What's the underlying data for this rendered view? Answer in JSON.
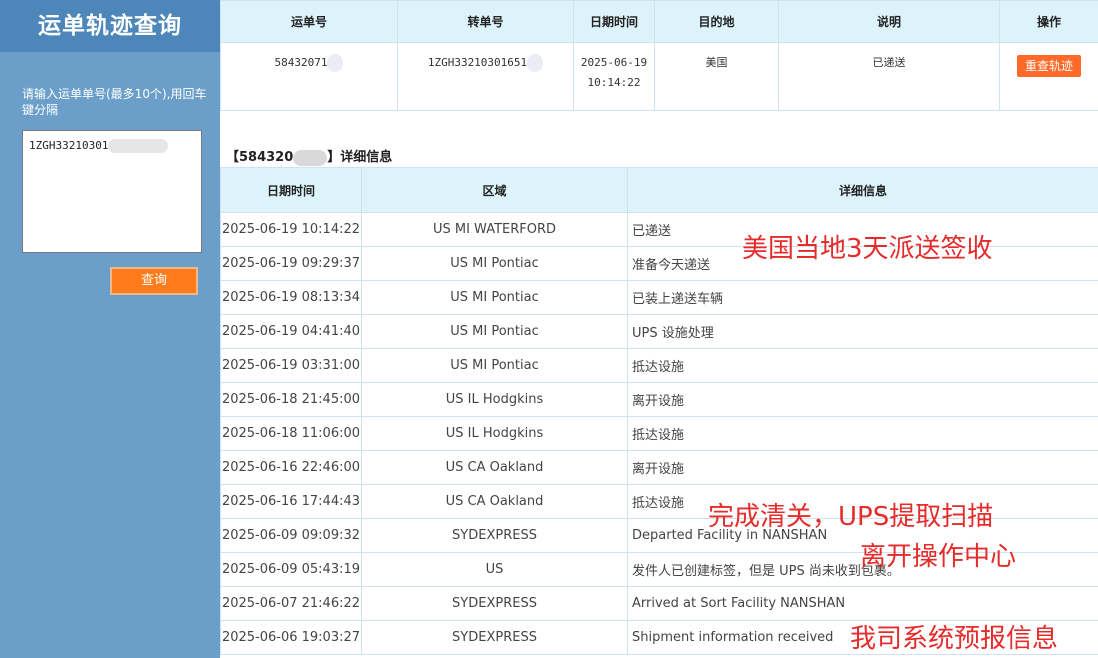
{
  "sidebar": {
    "title": "运单轨迹查询",
    "hint": "请输入运单单号(最多10个),用回车键分隔",
    "textarea_value": "1ZGH33210301",
    "query_label": "查询"
  },
  "summary": {
    "headers": [
      "运单号",
      "转单号",
      "日期时间",
      "目的地",
      "说明",
      "操作"
    ],
    "row": {
      "waybill": "58432071",
      "transfer": "1ZGH33210301651",
      "date": "2025-06-19",
      "time": "10:14:22",
      "destination": "美国",
      "note": "已递送",
      "action": "重查轨迹"
    }
  },
  "detail": {
    "heading_prefix": "【584320",
    "heading_suffix": "】详细信息",
    "headers": [
      "日期时间",
      "区域",
      "详细信息"
    ],
    "rows": [
      {
        "datetime": "2025-06-19 10:14:22",
        "area": "US MI WATERFORD",
        "info": "已递送"
      },
      {
        "datetime": "2025-06-19 09:29:37",
        "area": "US MI Pontiac",
        "info": "准备今天递送"
      },
      {
        "datetime": "2025-06-19 08:13:34",
        "area": "US MI Pontiac",
        "info": "已装上递送车辆"
      },
      {
        "datetime": "2025-06-19 04:41:40",
        "area": "US MI Pontiac",
        "info": "UPS 设施处理"
      },
      {
        "datetime": "2025-06-19 03:31:00",
        "area": "US MI Pontiac",
        "info": "抵达设施"
      },
      {
        "datetime": "2025-06-18 21:45:00",
        "area": "US IL Hodgkins",
        "info": "离开设施"
      },
      {
        "datetime": "2025-06-18 11:06:00",
        "area": "US IL Hodgkins",
        "info": "抵达设施"
      },
      {
        "datetime": "2025-06-16 22:46:00",
        "area": "US CA Oakland",
        "info": "离开设施"
      },
      {
        "datetime": "2025-06-16 17:44:43",
        "area": "US CA Oakland",
        "info": "抵达设施"
      },
      {
        "datetime": "2025-06-09 09:09:32",
        "area": "SYDEXPRESS",
        "info": "Departed Facility in NANSHAN"
      },
      {
        "datetime": "2025-06-09 05:43:19",
        "area": "US",
        "info": "发件人已创建标签，但是 UPS 尚未收到包裹。"
      },
      {
        "datetime": "2025-06-07 21:46:22",
        "area": "SYDEXPRESS",
        "info": "Arrived at Sort Facility NANSHAN"
      },
      {
        "datetime": "2025-06-06 19:03:27",
        "area": "SYDEXPRESS",
        "info": "Shipment information received"
      }
    ]
  },
  "annotations": {
    "delivery": "美国当地3天派送签收",
    "clearance_line1": "完成清关，UPS提取扫描",
    "clearance_line2": "离开操作中心",
    "prealert": "我司系统预报信息"
  },
  "colors": {
    "sidebar_bg": "#6b9fc9",
    "sidebar_title_bg": "#4d86b8",
    "header_bg": "#ddf3fb",
    "button_orange": "#ff6a2a",
    "annotation_red": "#e62b2b"
  }
}
